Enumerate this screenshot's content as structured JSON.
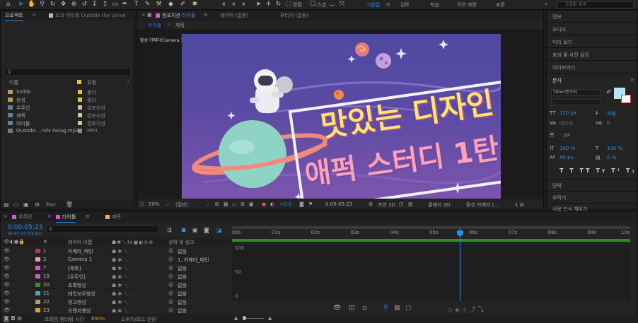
{
  "workspaces": {
    "default": "기본값",
    "review": "검토",
    "learn": "학습",
    "small_screen": "작은 화면",
    "standard": "표준"
  },
  "help_search": {
    "placeholder": "도움말 검색"
  },
  "toolbar": {
    "snap_label": "스냅",
    "align_label": "정렬"
  },
  "project_panel": {
    "tab_project": "프로젝트",
    "tab_effect": "효과 컨트롤 Outside the Unive",
    "col_name": "이름",
    "col_type": "유형",
    "items": [
      {
        "name": "Solids",
        "type": "폴더",
        "color": "#e6c23a"
      },
      {
        "name": "완성",
        "type": "폴더",
        "color": "#e6c23a"
      },
      {
        "name": "우주인",
        "type": "컴포지션",
        "color": "#c9c9a0"
      },
      {
        "name": "제목",
        "type": "컴포지션",
        "color": "#c9c9a0"
      },
      {
        "name": "타이틀",
        "type": "컴포지션",
        "color": "#c9c9a0"
      },
      {
        "name": "Outside....ndv Farag.mp3",
        "type": "MP3",
        "color": "#8a8a8a"
      }
    ],
    "bpc": "8bpc"
  },
  "composition_panel": {
    "tab_comp_prefix": "컴포지션",
    "tab_comp_name": "타이틀",
    "tab_layer": "레이어 (없음)",
    "tab_footage": "푸티지 (없음)",
    "sub_title": "타이틀",
    "sub_title2": "제목",
    "active_camera": "활성 카메라(Camera 1)",
    "title_line1": "맛있는 디자인",
    "title_line2": "애퍽 스터디 1탄",
    "zoom": "50%",
    "resolution": "(절반)",
    "exposure": "+0.0",
    "timecode": "0:00:05:23",
    "renderer": "클래식 3D",
    "camera": "활성 카메라 (...",
    "view": "1 뷰",
    "draft": "초안 3D"
  },
  "right_panel": {
    "items": [
      "정보",
      "오디오",
      "미리 보기",
      "효과 및 사전 설정",
      "라이브러리"
    ],
    "char_title": "문자",
    "font": "Tmon몬소리",
    "size": "120 px",
    "auto": "자동",
    "metrics": "메트릭",
    "zero": "0",
    "px": "px",
    "scale_v": "100 %",
    "scale_h": "100 %",
    "baseline": "40 px",
    "tsume": "0 %",
    "para_title": "단락",
    "tracker_title": "추적기",
    "content_aware": "내용 인식 채우기",
    "fill_color": "#a7e8ff"
  },
  "timeline": {
    "tabs": [
      "우주인",
      "타이틀",
      "제목"
    ],
    "timecode": "0:00:05:23",
    "frames": "00143 (23.976 fps)",
    "col_layer_name": "레이어 이름",
    "col_parent": "상위 및 링크",
    "layers": [
      {
        "num": "1",
        "name": "카메라_메인",
        "parent": "없음",
        "color": "#b23a3a"
      },
      {
        "num": "2",
        "name": "Camera 1",
        "parent": "1. 카메라_메인",
        "color": "#e8a0b0"
      },
      {
        "num": "7",
        "name": "[제목]",
        "parent": "없음",
        "color": "#d45ad4"
      },
      {
        "num": "19",
        "name": "[우주인]",
        "parent": "없음",
        "color": "#d45ad4"
      },
      {
        "num": "20",
        "name": "초록행성",
        "parent": "없음",
        "color": "#3c8a3c"
      },
      {
        "num": "21",
        "name": "레인보우행성",
        "parent": "없음",
        "color": "#3ab0b0"
      },
      {
        "num": "22",
        "name": "핑크행성",
        "parent": "없음",
        "color": "#b09a80"
      },
      {
        "num": "23",
        "name": "오렌지행성",
        "parent": "없음",
        "color": "#e89a2a"
      }
    ],
    "ruler": [
      "00s",
      "01s",
      "02s",
      "03s",
      "04s",
      "05s",
      "06s",
      "07s",
      "08s",
      "09s",
      "10s"
    ],
    "graph_labels": [
      "100",
      "50",
      "0"
    ],
    "footer_label": "프레임 렌더링 시간",
    "footer_value": "89ms",
    "footer_toggle": "스위치/모드 전환"
  }
}
